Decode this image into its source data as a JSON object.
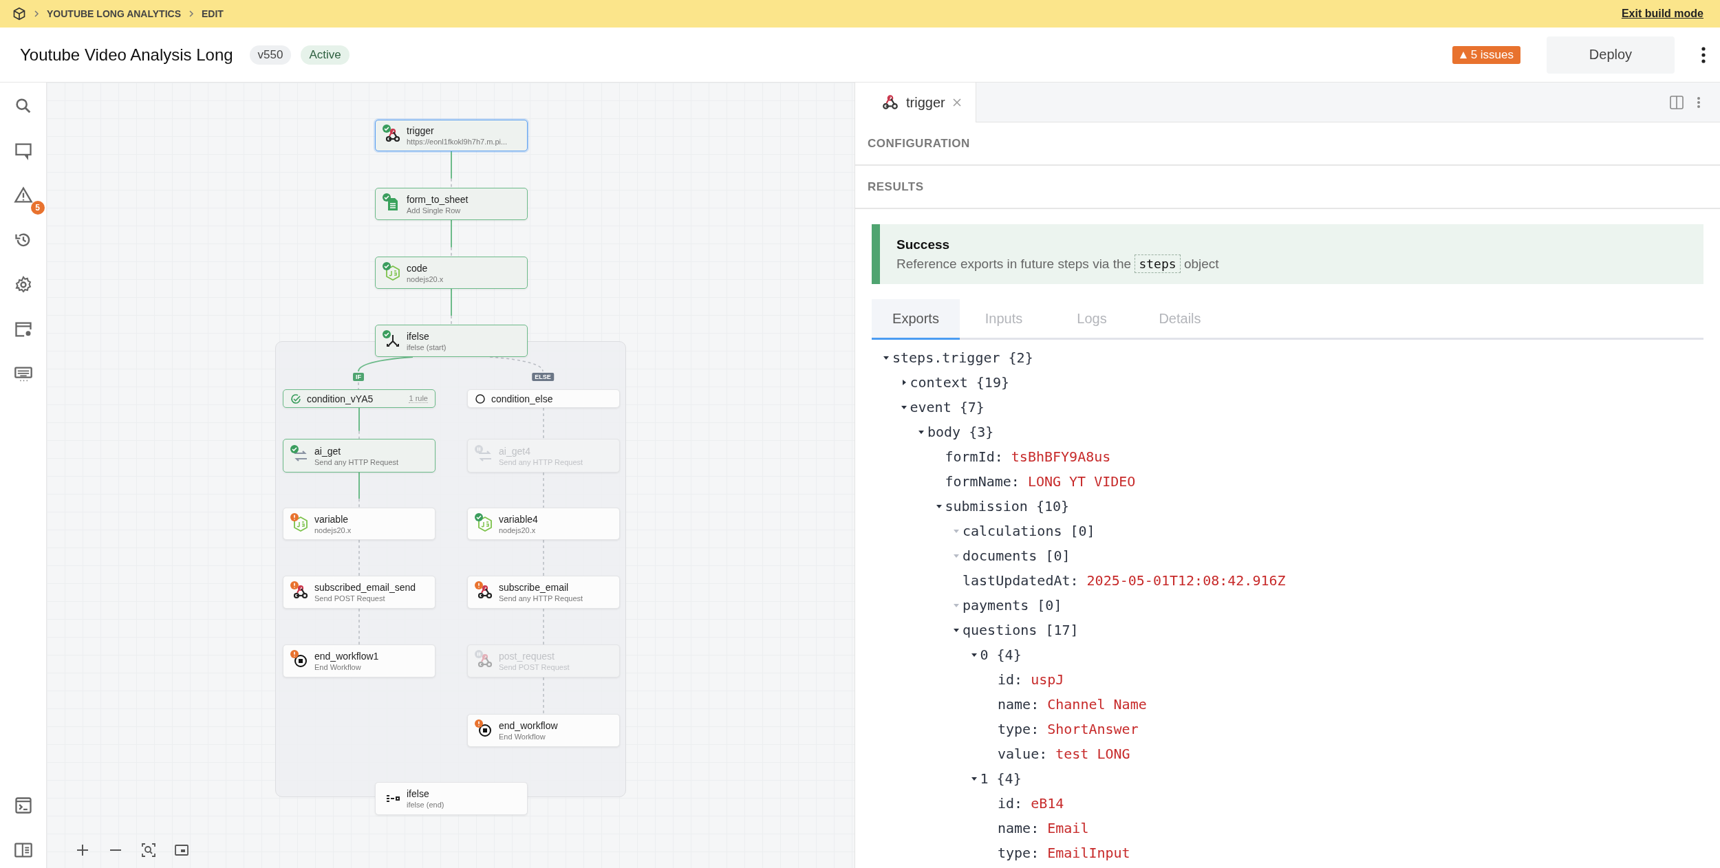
{
  "breadcrumb": {
    "items": [
      "YOUTUBE LONG ANALYTICS",
      "EDIT"
    ],
    "exit": "Exit build mode"
  },
  "header": {
    "title": "Youtube Video Analysis Long",
    "version": "v550",
    "status": "Active",
    "issues": "5 issues",
    "deploy": "Deploy"
  },
  "sidebar": {
    "issues_badge": "5"
  },
  "canvas": {
    "nodes": [
      {
        "kind": "webhook",
        "name": "trigger",
        "subtitle": "https://eonl1fkokl9h7h7.m.pi...",
        "passed": true,
        "failed": false,
        "paused": false,
        "executed": true,
        "selected": true,
        "disabled": false
      },
      {
        "kind": "sheet",
        "name": "form_to_sheet",
        "subtitle": "Add Single Row",
        "passed": true,
        "failed": false,
        "paused": false,
        "executed": true,
        "selected": false,
        "disabled": false
      },
      {
        "kind": "js",
        "name": "code",
        "subtitle": "nodejs20.x",
        "passed": true,
        "failed": false,
        "paused": false,
        "executed": true,
        "selected": false,
        "disabled": false
      },
      {
        "kind": "branch",
        "name": "ifelse",
        "subtitle": "ifelse (start)",
        "passed": true,
        "failed": false,
        "paused": false,
        "executed": true,
        "selected": false,
        "disabled": false
      },
      {
        "kind": "condition",
        "name": "condition_vYA5",
        "rule": "1 rule",
        "passed": true,
        "executed": true,
        "selected": false
      },
      {
        "kind": "condition",
        "name": "condition_else",
        "passed": false,
        "executed": false,
        "selected": false
      },
      {
        "kind": "http",
        "name": "ai_get",
        "subtitle": "Send any HTTP Request",
        "passed": true,
        "failed": false,
        "paused": false,
        "executed": true,
        "selected": false,
        "disabled": false
      },
      {
        "kind": "http",
        "name": "ai_get4",
        "subtitle": "Send any HTTP Request",
        "passed": false,
        "failed": false,
        "paused": true,
        "executed": false,
        "selected": false,
        "disabled": true
      },
      {
        "kind": "js",
        "name": "variable",
        "subtitle": "nodejs20.x",
        "passed": false,
        "failed": true,
        "paused": false,
        "executed": false,
        "selected": false,
        "disabled": false
      },
      {
        "kind": "js",
        "name": "variable4",
        "subtitle": "nodejs20.x",
        "passed": true,
        "failed": false,
        "paused": false,
        "executed": false,
        "selected": false,
        "disabled": false
      },
      {
        "kind": "webhook",
        "name": "subscribed_email_send",
        "subtitle": "Send POST Request",
        "passed": false,
        "failed": true,
        "paused": false,
        "executed": false,
        "selected": false,
        "disabled": false
      },
      {
        "kind": "webhook",
        "name": "subscribe_email",
        "subtitle": "Send any HTTP Request",
        "passed": false,
        "failed": true,
        "paused": false,
        "executed": false,
        "selected": false,
        "disabled": false
      },
      {
        "kind": "end",
        "name": "end_workflow1",
        "subtitle": "End Workflow",
        "passed": false,
        "failed": true,
        "paused": false,
        "executed": false,
        "selected": false,
        "disabled": false
      },
      {
        "kind": "webhook",
        "name": "post_request",
        "subtitle": "Send POST Request",
        "passed": false,
        "failed": false,
        "paused": true,
        "executed": false,
        "selected": false,
        "disabled": true
      },
      {
        "kind": "end",
        "name": "end_workflow",
        "subtitle": "End Workflow",
        "passed": false,
        "failed": true,
        "paused": false,
        "executed": false,
        "selected": false,
        "disabled": false
      },
      {
        "kind": "merge",
        "name": "ifelse",
        "subtitle": "ifelse (end)",
        "passed": false,
        "failed": false,
        "paused": false,
        "executed": false,
        "selected": false,
        "disabled": false
      }
    ],
    "branch_labels": [
      {
        "label": "IF",
        "kind": "if"
      },
      {
        "label": "ELSE",
        "kind": "else"
      }
    ]
  },
  "panel": {
    "tab": {
      "label": "trigger"
    },
    "sections": [
      "CONFIGURATION",
      "RESULTS"
    ],
    "alert": {
      "title": "Success",
      "text_before": "Reference exports in future steps via the",
      "code": "steps",
      "text_after": "object"
    },
    "tabs": [
      {
        "label": "Exports",
        "selected": true
      },
      {
        "label": "Inputs",
        "selected": false
      },
      {
        "label": "Logs",
        "selected": false
      },
      {
        "label": "Details",
        "selected": false
      }
    ],
    "tree": [
      {
        "kind": "object",
        "key": "steps.trigger",
        "count": "{2}",
        "expanded": true,
        "children": [
          {
            "kind": "object",
            "key": "context",
            "count": "{19}",
            "expanded": false
          },
          {
            "kind": "object",
            "key": "event",
            "count": "{7}",
            "expanded": true,
            "children": [
              {
                "kind": "object",
                "key": "body",
                "count": "{3}",
                "expanded": true,
                "children": [
                  {
                    "kind": "value",
                    "key": "formId:",
                    "value": "tsBhBFY9A8us"
                  },
                  {
                    "kind": "value",
                    "key": "formName:",
                    "value": "LONG YT VIDEO"
                  },
                  {
                    "kind": "object",
                    "key": "submission",
                    "count": "{10}",
                    "expanded": true,
                    "children": [
                      {
                        "kind": "empty",
                        "key": "calculations",
                        "count": "[0]"
                      },
                      {
                        "kind": "empty",
                        "key": "documents",
                        "count": "[0]"
                      },
                      {
                        "kind": "value",
                        "key": "lastUpdatedAt:",
                        "value": "2025-05-01T12:08:42.916Z"
                      },
                      {
                        "kind": "empty",
                        "key": "payments",
                        "count": "[0]"
                      },
                      {
                        "kind": "object",
                        "key": "questions",
                        "count": "[17]",
                        "expanded": true,
                        "children": [
                          {
                            "kind": "object",
                            "key": "0",
                            "count": "{4}",
                            "expanded": true,
                            "children": [
                              {
                                "kind": "value",
                                "key": "id:",
                                "value": "uspJ"
                              },
                              {
                                "kind": "value",
                                "key": "name:",
                                "value": "Channel Name"
                              },
                              {
                                "kind": "value",
                                "key": "type:",
                                "value": "ShortAnswer"
                              },
                              {
                                "kind": "value",
                                "key": "value:",
                                "value": "test LONG"
                              }
                            ]
                          },
                          {
                            "kind": "object",
                            "key": "1",
                            "count": "{4}",
                            "expanded": true,
                            "children": [
                              {
                                "kind": "value",
                                "key": "id:",
                                "value": "eB14"
                              },
                              {
                                "kind": "value",
                                "key": "name:",
                                "value": "Email"
                              },
                              {
                                "kind": "value",
                                "key": "type:",
                                "value": "EmailInput"
                              }
                            ]
                          }
                        ]
                      }
                    ]
                  }
                ]
              }
            ]
          }
        ]
      }
    ]
  }
}
